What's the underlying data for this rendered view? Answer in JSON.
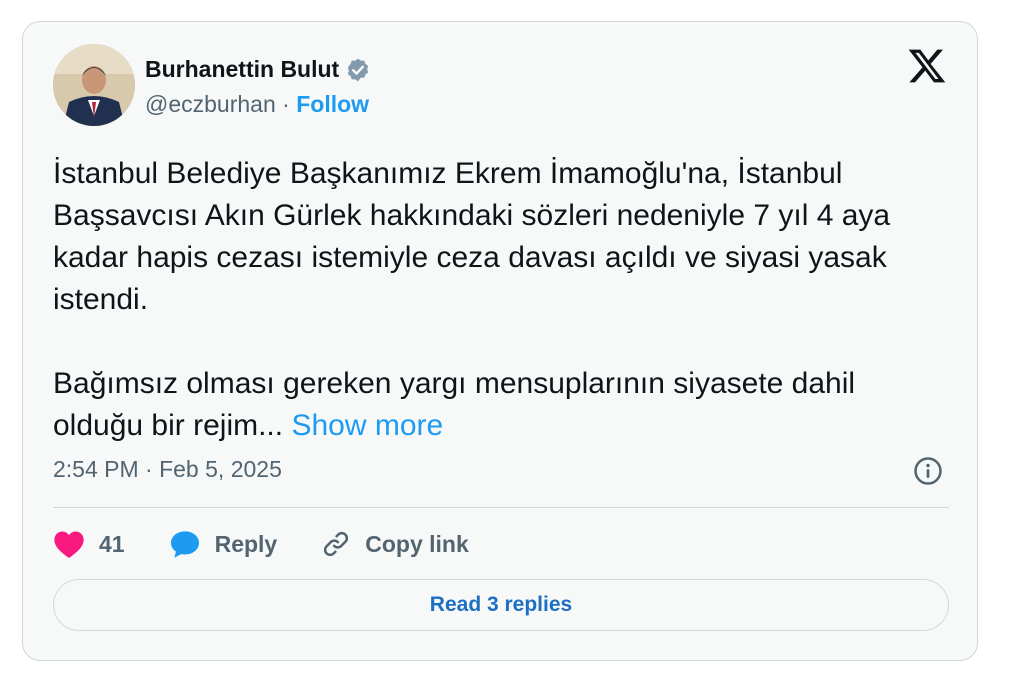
{
  "author": {
    "name": "Burhanettin Bulut",
    "handle": "@eczburhan",
    "separator": "·",
    "follow_label": "Follow",
    "verified_icon": "verified-badge-icon"
  },
  "tweet": {
    "paragraph1": "İstanbul Belediye Başkanımız Ekrem İmamoğlu'na, İstanbul Başsavcısı Akın Gürlek hakkındaki sözleri nedeniyle 7 yıl 4 aya kadar hapis cezası istemiyle ceza davası açıldı ve siyasi yasak istendi.",
    "paragraph2": "Bağımsız olması gereken yargı mensuplarının siyasete dahil olduğu bir rejim...",
    "show_more": "Show more",
    "timestamp": "2:54 PM · Feb 5, 2025"
  },
  "actions": {
    "likes": "41",
    "reply_label": "Reply",
    "copy_link_label": "Copy link"
  },
  "read_replies": "Read 3 replies",
  "colors": {
    "accent": "#1d9bf0",
    "heart": "#f91880",
    "text": "#0f1419",
    "muted": "#536471",
    "card_bg": "#f7f9f9",
    "border": "#cfd9de"
  }
}
